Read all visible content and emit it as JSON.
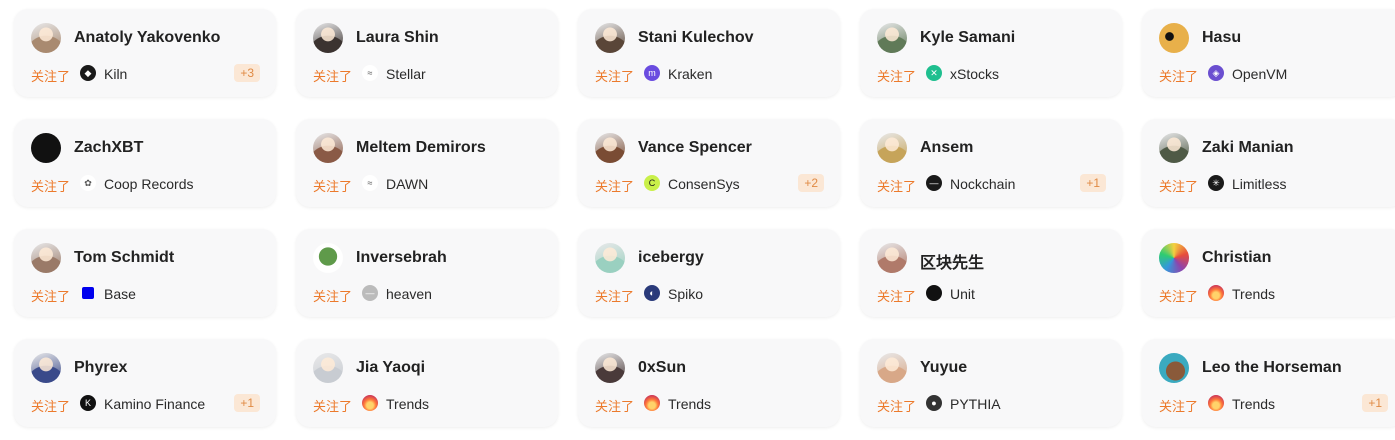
{
  "follow_label": "关注了",
  "cards": [
    {
      "name": "Anatoly Yakovenko",
      "avatar": {
        "icon": "person-photo-avatar",
        "color": "#a98a70"
      },
      "project": "Kiln",
      "project_icon": {
        "icon": "kiln-logo",
        "color": "#1a1a1a",
        "glyph": "◆"
      },
      "extra": "+3"
    },
    {
      "name": "Laura Shin",
      "avatar": {
        "icon": "person-photo-avatar",
        "color": "#3b3330"
      },
      "project": "Stellar",
      "project_icon": {
        "icon": "stellar-logo",
        "color": "#ffffff",
        "glyph": "≈"
      },
      "extra": ""
    },
    {
      "name": "Stani Kulechov",
      "avatar": {
        "icon": "person-photo-avatar",
        "color": "#5a4638"
      },
      "project": "Kraken",
      "project_icon": {
        "icon": "kraken-logo",
        "color": "#6a4ce0",
        "glyph": "m"
      },
      "extra": ""
    },
    {
      "name": "Kyle Samani",
      "avatar": {
        "icon": "person-photo-avatar",
        "color": "#607a58"
      },
      "project": "xStocks",
      "project_icon": {
        "icon": "xstocks-logo",
        "color": "#1fbf8f",
        "glyph": "✕"
      },
      "extra": ""
    },
    {
      "name": "Hasu",
      "avatar": {
        "icon": "cartoon-avatar",
        "color": "#e8b04a"
      },
      "project": "OpenVM",
      "project_icon": {
        "icon": "openvm-logo",
        "color": "#6b4fd0",
        "glyph": "◈"
      },
      "extra": ""
    },
    {
      "name": "ZachXBT",
      "avatar": {
        "icon": "dark-avatar",
        "color": "#111111"
      },
      "project": "Coop Records",
      "project_icon": {
        "icon": "coop-records-logo",
        "color": "#ffffff",
        "glyph": "✿"
      },
      "extra": ""
    },
    {
      "name": "Meltem Demirors",
      "avatar": {
        "icon": "person-photo-avatar",
        "color": "#8a5a46"
      },
      "project": "DAWN",
      "project_icon": {
        "icon": "dawn-logo",
        "color": "#ffffff",
        "glyph": "≈"
      },
      "extra": ""
    },
    {
      "name": "Vance Spencer",
      "avatar": {
        "icon": "person-photo-avatar",
        "color": "#7a4c34"
      },
      "project": "ConsenSys",
      "project_icon": {
        "icon": "consensys-logo",
        "color": "#c9f04a",
        "glyph": "C"
      },
      "extra": "+2"
    },
    {
      "name": "Ansem",
      "avatar": {
        "icon": "cartoon-avatar",
        "color": "#c6a45a"
      },
      "project": "Nockchain",
      "project_icon": {
        "icon": "nockchain-logo",
        "color": "#1a1a1a",
        "glyph": "—"
      },
      "extra": "+1"
    },
    {
      "name": "Zaki Manian",
      "avatar": {
        "icon": "person-photo-avatar",
        "color": "#4f5a46"
      },
      "project": "Limitless",
      "project_icon": {
        "icon": "limitless-logo",
        "color": "#1a1a1a",
        "glyph": "✳"
      },
      "extra": ""
    },
    {
      "name": "Tom Schmidt",
      "avatar": {
        "icon": "person-photo-avatar",
        "color": "#9a7a68"
      },
      "project": "Base",
      "project_icon": {
        "icon": "base-logo",
        "color": "#0000ee",
        "glyph": ""
      },
      "extra": ""
    },
    {
      "name": "Inversebrah",
      "avatar": {
        "icon": "pepe-avatar",
        "color": "#5f9a4a"
      },
      "project": "heaven",
      "project_icon": {
        "icon": "heaven-logo",
        "color": "#bbbbbb",
        "glyph": "—"
      },
      "extra": ""
    },
    {
      "name": "icebergy",
      "avatar": {
        "icon": "cartoon-avatar",
        "color": "#9ad0c0"
      },
      "project": "Spiko",
      "project_icon": {
        "icon": "spiko-logo",
        "color": "#2a3a7a",
        "glyph": "◐"
      },
      "extra": ""
    },
    {
      "name": "区块先生",
      "avatar": {
        "icon": "person-photo-avatar",
        "color": "#b07a6a"
      },
      "project": "Unit",
      "project_icon": {
        "icon": "unit-logo",
        "color": "#111111",
        "glyph": ""
      },
      "extra": ""
    },
    {
      "name": "Christian",
      "avatar": {
        "icon": "rainbow-avatar",
        "color": "#e84a8a"
      },
      "project": "Trends",
      "project_icon": {
        "icon": "fire-icon",
        "color": "#e8504a",
        "glyph": "🔥"
      },
      "extra": ""
    },
    {
      "name": "Phyrex",
      "avatar": {
        "icon": "person-photo-avatar",
        "color": "#3a4a8a"
      },
      "project": "Kamino Finance",
      "project_icon": {
        "icon": "kamino-logo",
        "color": "#111111",
        "glyph": "K"
      },
      "extra": "+1"
    },
    {
      "name": "Jia Yaoqi",
      "avatar": {
        "icon": "person-photo-avatar",
        "color": "#c8ccd2"
      },
      "project": "Trends",
      "project_icon": {
        "icon": "fire-icon",
        "color": "#e8504a",
        "glyph": "🔥"
      },
      "extra": ""
    },
    {
      "name": "0xSun",
      "avatar": {
        "icon": "person-photo-avatar",
        "color": "#4a3a3a"
      },
      "project": "Trends",
      "project_icon": {
        "icon": "fire-icon",
        "color": "#e8504a",
        "glyph": "🔥"
      },
      "extra": ""
    },
    {
      "name": "Yuyue",
      "avatar": {
        "icon": "anime-avatar",
        "color": "#d8a888"
      },
      "project": "PYTHIA",
      "project_icon": {
        "icon": "pythia-logo",
        "color": "#333333",
        "glyph": "●"
      },
      "extra": ""
    },
    {
      "name": "Leo the Horseman",
      "avatar": {
        "icon": "horse-avatar",
        "color": "#3aaac0"
      },
      "project": "Trends",
      "project_icon": {
        "icon": "fire-icon",
        "color": "#e8504a",
        "glyph": "🔥"
      },
      "extra": "+1"
    }
  ]
}
